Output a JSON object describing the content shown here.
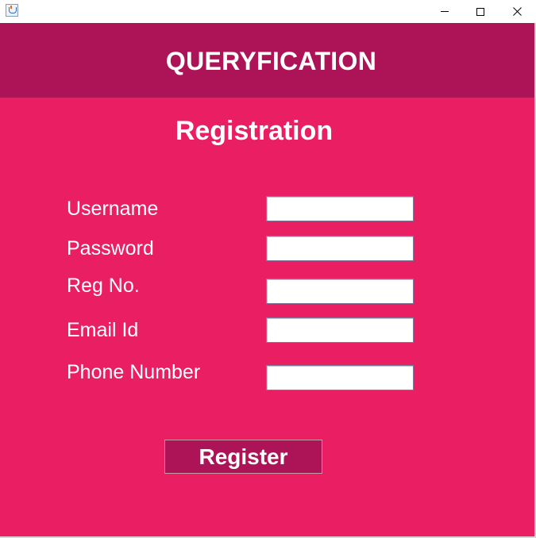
{
  "window": {
    "app_icon": "java-cup-icon",
    "controls": [
      "minimize-icon",
      "maximize-icon",
      "close-icon"
    ]
  },
  "header": {
    "title": "QUERYFICATION"
  },
  "form": {
    "title": "Registration",
    "fields": [
      {
        "label": "Username",
        "value": ""
      },
      {
        "label": "Password",
        "value": ""
      },
      {
        "label": "Reg No.",
        "value": ""
      },
      {
        "label": "Email Id",
        "value": ""
      },
      {
        "label": "Phone Number",
        "value": ""
      }
    ],
    "submit_label": "Register"
  },
  "colors": {
    "background": "#e91e63",
    "header": "#ad1457",
    "button": "#ad1457",
    "text": "#ffffff"
  }
}
